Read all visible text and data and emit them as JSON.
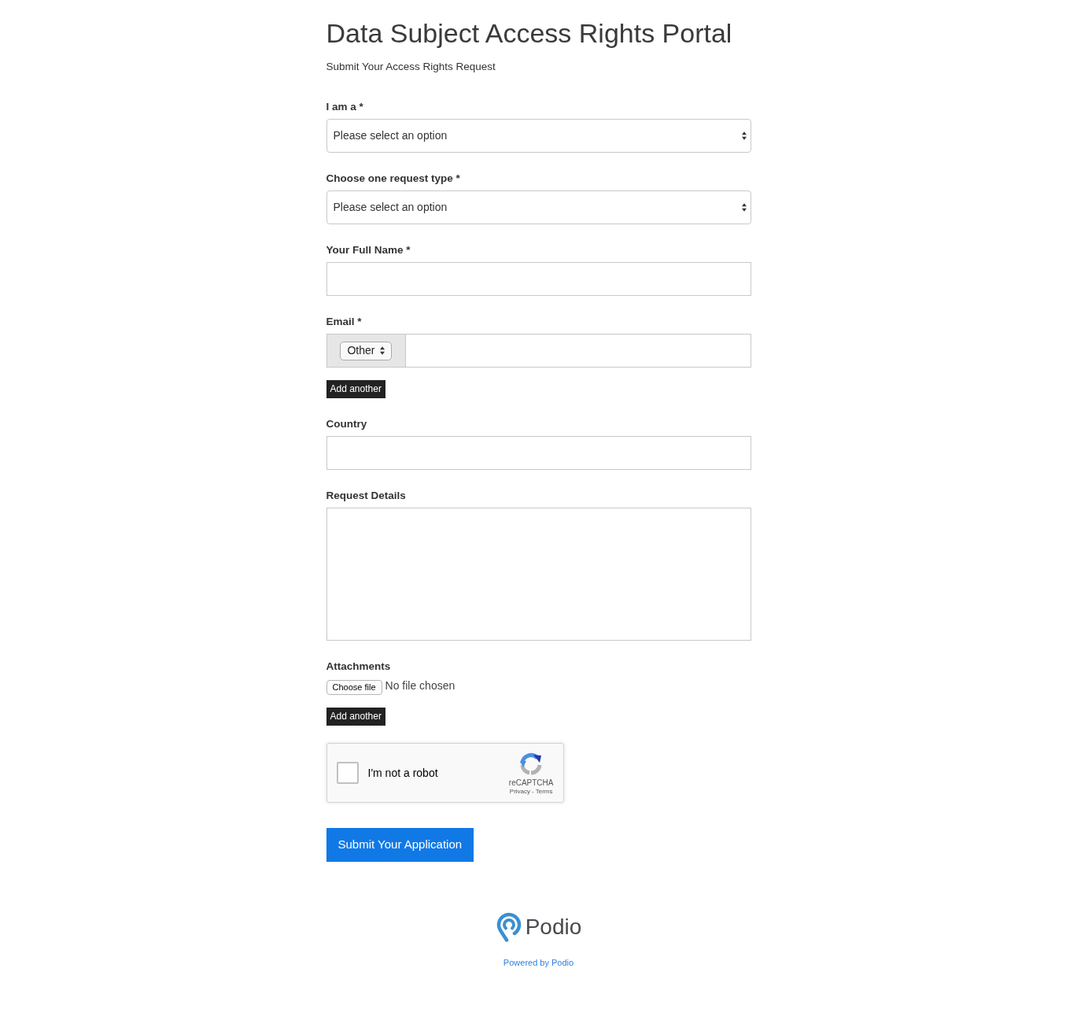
{
  "header": {
    "title": "Data Subject Access Rights Portal",
    "subtitle": "Submit Your Access Rights Request"
  },
  "fields": [
    {
      "kind": "select",
      "label": "I am a *",
      "value": "Please select an option"
    },
    {
      "kind": "select",
      "label": "Choose one request type *",
      "value": "Please select an option"
    },
    {
      "kind": "text",
      "label": "Your Full Name *"
    },
    {
      "kind": "email",
      "label": "Email *",
      "type_value": "Other",
      "add_label": "Add another"
    },
    {
      "kind": "text",
      "label": "Country"
    },
    {
      "kind": "textarea",
      "label": "Request Details"
    },
    {
      "kind": "file",
      "label": "Attachments",
      "button_label": "Choose file",
      "status": "No file chosen",
      "add_label": "Add another"
    }
  ],
  "captcha": {
    "checked": false,
    "label": "I'm not a robot",
    "brand": "reCAPTCHA",
    "privacy": "Privacy",
    "separator": "-",
    "terms": "Terms"
  },
  "submit": {
    "label": "Submit Your Application"
  },
  "footer": {
    "logo_text": "Podio",
    "powered_by": "Powered by Podio"
  }
}
